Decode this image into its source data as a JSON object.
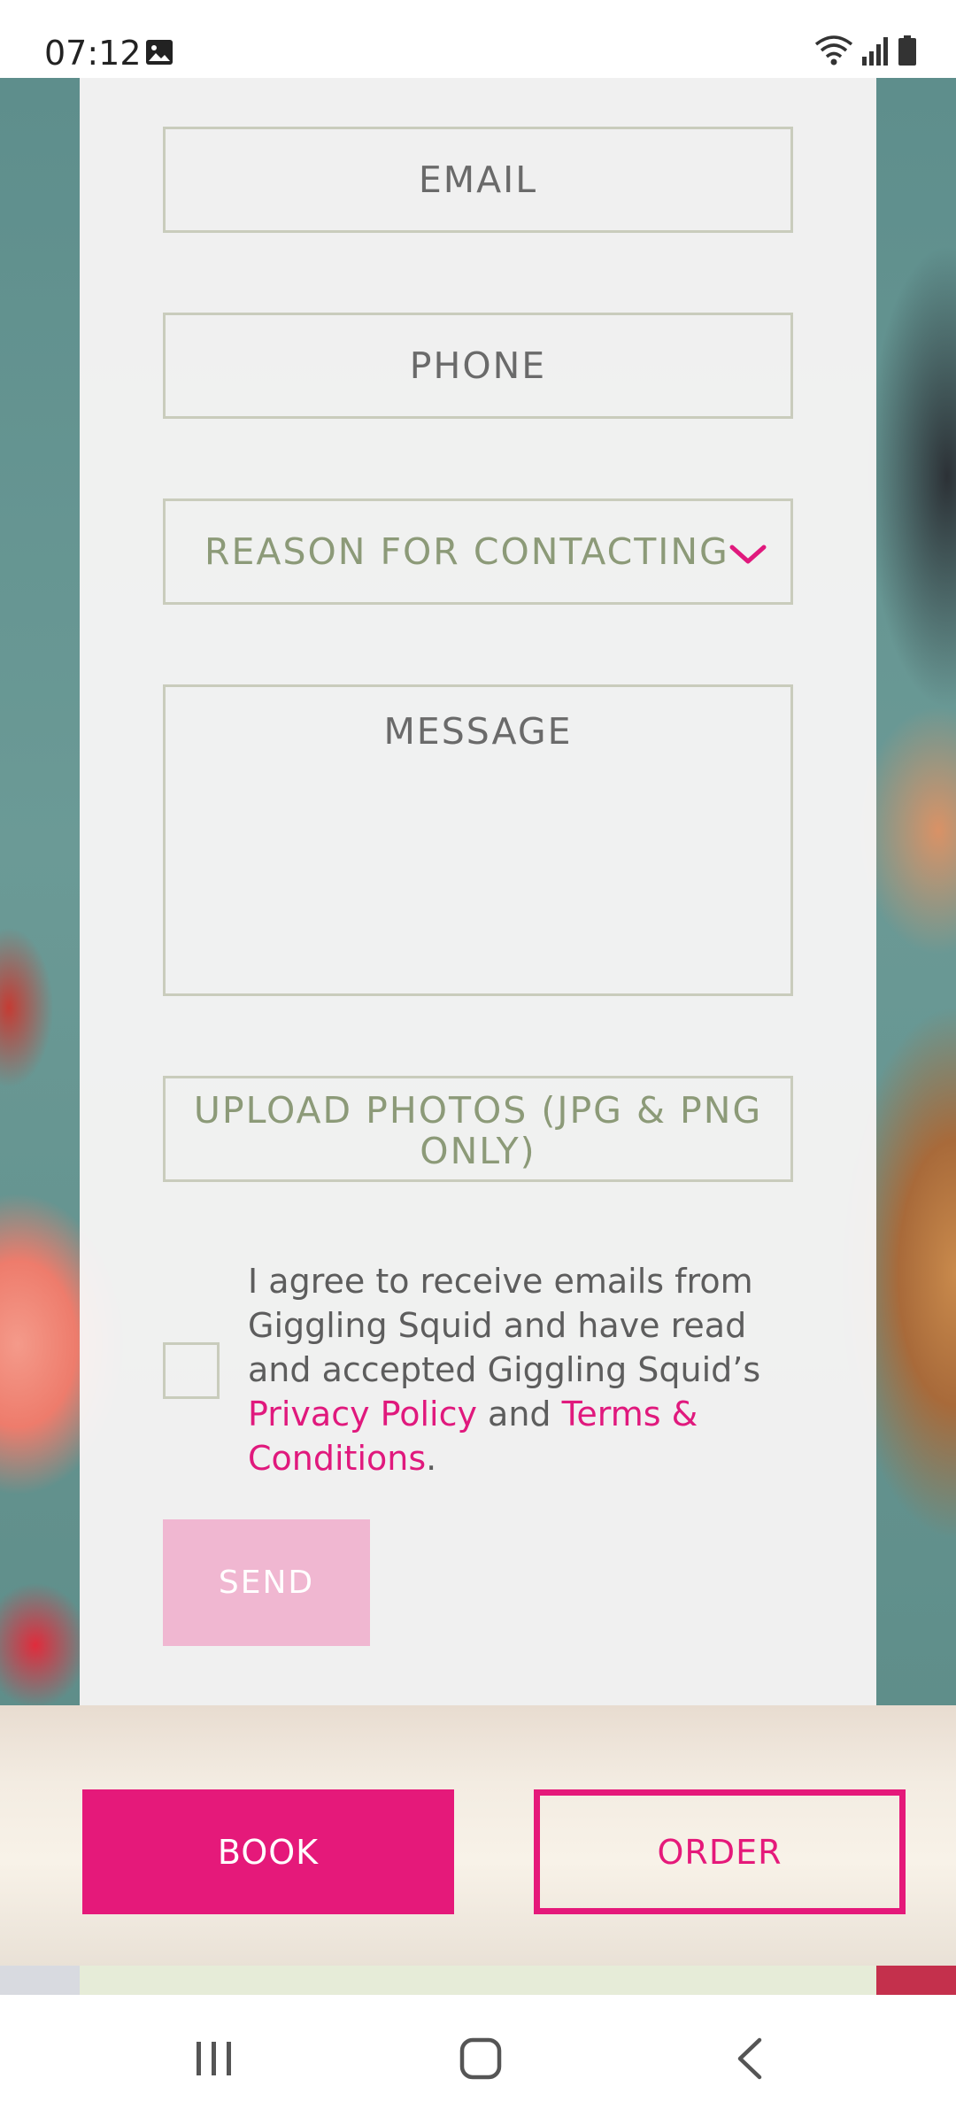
{
  "status_bar": {
    "time": "07:12"
  },
  "form": {
    "email_placeholder": "EMAIL",
    "phone_placeholder": "PHONE",
    "reason_label": "REASON FOR CONTACTING",
    "message_placeholder": "MESSAGE",
    "upload_line1": "UPLOAD PHOTOS (JPG & PNG",
    "upload_line2": "ONLY)",
    "consent": {
      "text_before": "I agree to receive emails from Giggling Squid and have read and accepted Giggling Squid’s ",
      "privacy_link": "Privacy Policy",
      "middle": " and ",
      "terms_link": "Terms & Conditions",
      "end": "."
    },
    "send_label": "SEND"
  },
  "bottom_bar": {
    "book_label": "BOOK",
    "order_label": "ORDER"
  },
  "colors": {
    "accent": "#e5197a",
    "send_disabled": "#f0b7d1",
    "field_border": "#c9ccbc"
  },
  "icons": {
    "status_left": "gallery-icon",
    "status_right": [
      "wifi-icon",
      "signal-icon",
      "battery-icon"
    ],
    "dropdown": "chevron-down-icon",
    "nav": [
      "recents-icon",
      "home-icon",
      "back-icon"
    ]
  }
}
